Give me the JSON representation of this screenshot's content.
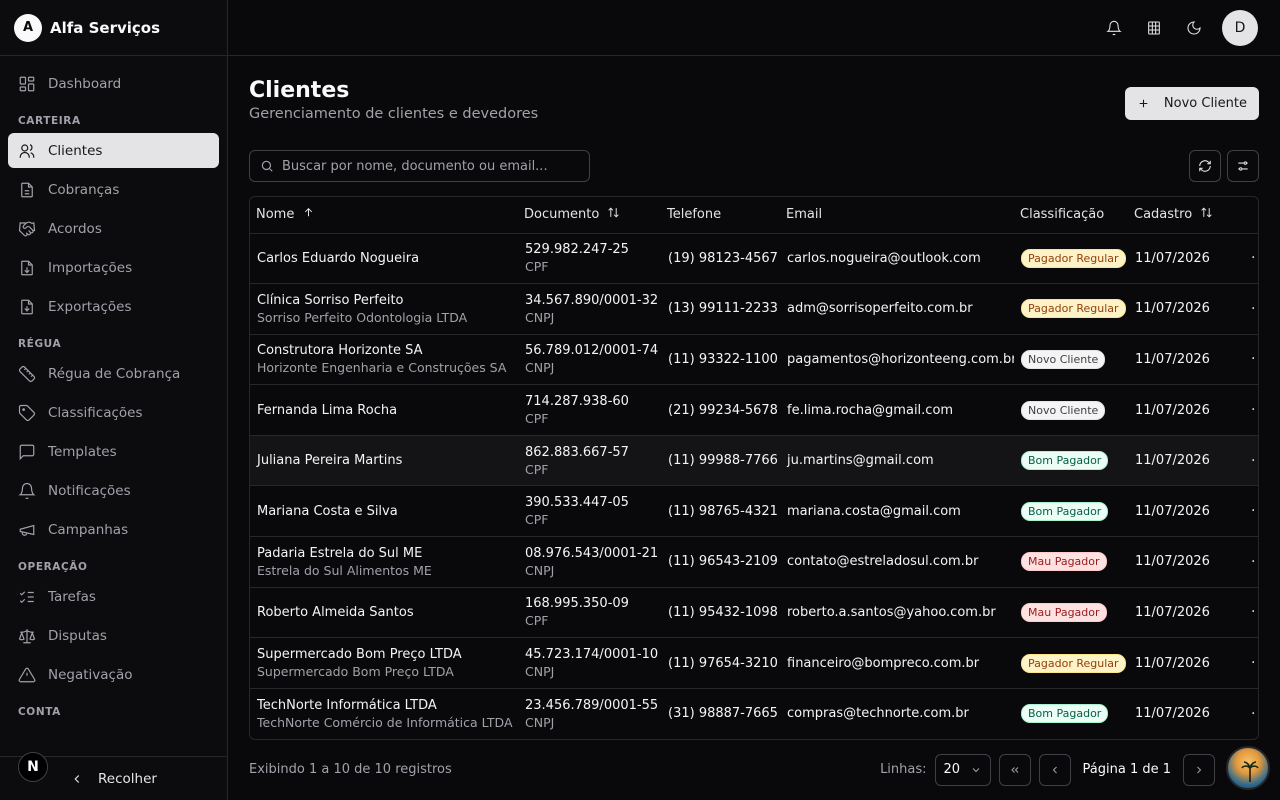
{
  "brand": {
    "initial": "A",
    "name": "Alfa Serviços"
  },
  "sidebar": {
    "top": [
      {
        "label": "Dashboard",
        "icon": "dashboard-icon"
      }
    ],
    "sections": [
      {
        "title": "CARTEIRA",
        "items": [
          {
            "label": "Clientes",
            "icon": "users-icon",
            "active": true
          },
          {
            "label": "Cobranças",
            "icon": "file-text-icon"
          },
          {
            "label": "Acordos",
            "icon": "handshake-icon"
          },
          {
            "label": "Importações",
            "icon": "file-import-icon"
          },
          {
            "label": "Exportações",
            "icon": "file-export-icon"
          }
        ]
      },
      {
        "title": "RÉGUA",
        "items": [
          {
            "label": "Régua de Cobrança",
            "icon": "ruler-icon"
          },
          {
            "label": "Classificações",
            "icon": "tag-icon"
          },
          {
            "label": "Templates",
            "icon": "message-square-icon"
          },
          {
            "label": "Notificações",
            "icon": "bell-icon"
          },
          {
            "label": "Campanhas",
            "icon": "megaphone-icon"
          }
        ]
      },
      {
        "title": "OPERAÇÃO",
        "items": [
          {
            "label": "Tarefas",
            "icon": "list-checks-icon"
          },
          {
            "label": "Disputas",
            "icon": "scale-icon"
          },
          {
            "label": "Negativação",
            "icon": "alert-triangle-icon"
          }
        ]
      },
      {
        "title": "CONTA",
        "items": []
      }
    ],
    "collapse_label": "Recolher",
    "next_badge": "N"
  },
  "topbar": {
    "user_initial": "D"
  },
  "page": {
    "title": "Clientes",
    "subtitle": "Gerenciamento de clientes e devedores",
    "new_button": "Novo Cliente",
    "search_placeholder": "Buscar por nome, documento ou email..."
  },
  "table": {
    "columns": [
      "Nome",
      "Documento",
      "Telefone",
      "Email",
      "Classificação",
      "Cadastro"
    ],
    "rows": [
      {
        "name": "Carlos Eduardo Nogueira",
        "company": "",
        "doc": "529.982.247-25",
        "doc_type": "CPF",
        "phone": "(19) 98123-4567",
        "email": "carlos.nogueira@outlook.com",
        "class": "Pagador Regular",
        "date": "11/07/2026"
      },
      {
        "name": "Clínica Sorriso Perfeito",
        "company": "Sorriso Perfeito Odontologia LTDA",
        "doc": "34.567.890/0001-32",
        "doc_type": "CNPJ",
        "phone": "(13) 99111-2233",
        "email": "adm@sorrisoperfeito.com.br",
        "class": "Pagador Regular",
        "date": "11/07/2026"
      },
      {
        "name": "Construtora Horizonte SA",
        "company": "Horizonte Engenharia e Construções SA",
        "doc": "56.789.012/0001-74",
        "doc_type": "CNPJ",
        "phone": "(11) 93322-1100",
        "email": "pagamentos@horizonteeng.com.br",
        "class": "Novo Cliente",
        "date": "11/07/2026"
      },
      {
        "name": "Fernanda Lima Rocha",
        "company": "",
        "doc": "714.287.938-60",
        "doc_type": "CPF",
        "phone": "(21) 99234-5678",
        "email": "fe.lima.rocha@gmail.com",
        "class": "Novo Cliente",
        "date": "11/07/2026"
      },
      {
        "name": "Juliana Pereira Martins",
        "company": "",
        "doc": "862.883.667-57",
        "doc_type": "CPF",
        "phone": "(11) 99988-7766",
        "email": "ju.martins@gmail.com",
        "class": "Bom Pagador",
        "date": "11/07/2026"
      },
      {
        "name": "Mariana Costa e Silva",
        "company": "",
        "doc": "390.533.447-05",
        "doc_type": "CPF",
        "phone": "(11) 98765-4321",
        "email": "mariana.costa@gmail.com",
        "class": "Bom Pagador",
        "date": "11/07/2026"
      },
      {
        "name": "Padaria Estrela do Sul ME",
        "company": "Estrela do Sul Alimentos ME",
        "doc": "08.976.543/0001-21",
        "doc_type": "CNPJ",
        "phone": "(11) 96543-2109",
        "email": "contato@estreladosul.com.br",
        "class": "Mau Pagador",
        "date": "11/07/2026"
      },
      {
        "name": "Roberto Almeida Santos",
        "company": "",
        "doc": "168.995.350-09",
        "doc_type": "CPF",
        "phone": "(11) 95432-1098",
        "email": "roberto.a.santos@yahoo.com.br",
        "class": "Mau Pagador",
        "date": "11/07/2026"
      },
      {
        "name": "Supermercado Bom Preço LTDA",
        "company": "Supermercado Bom Preço LTDA",
        "doc": "45.723.174/0001-10",
        "doc_type": "CNPJ",
        "phone": "(11) 97654-3210",
        "email": "financeiro@bompreco.com.br",
        "class": "Pagador Regular",
        "date": "11/07/2026"
      },
      {
        "name": "TechNorte Informática LTDA",
        "company": "TechNorte Comércio de Informática LTDA",
        "doc": "23.456.789/0001-55",
        "doc_type": "CNPJ",
        "phone": "(31) 98887-7665",
        "email": "compras@technorte.com.br",
        "class": "Bom Pagador",
        "date": "11/07/2026"
      }
    ],
    "row_menu": "···"
  },
  "badge_colors": {
    "Pagador Regular": {
      "bg": "#fef3c7",
      "fg": "#92400e",
      "border": "#fde68a"
    },
    "Novo Cliente": {
      "bg": "#f4f4f5",
      "fg": "#3f3f46",
      "border": "#e4e4e7"
    },
    "Bom Pagador": {
      "bg": "#ecfdf5",
      "fg": "#065f46",
      "border": "#a7f3d0"
    },
    "Mau Pagador": {
      "bg": "#fee2e2",
      "fg": "#991b1b",
      "border": "#fecaca"
    }
  },
  "footer": {
    "count_text": "Exibindo 1 a 10 de 10 registros",
    "rows_label": "Linhas:",
    "rows_value": "20",
    "page_text": "Página 1 de 1"
  }
}
